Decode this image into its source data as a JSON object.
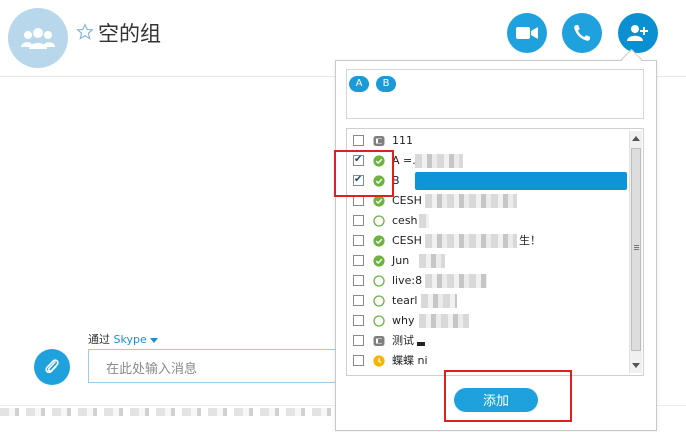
{
  "header": {
    "title": "空的组",
    "buttons": [
      {
        "name": "video-call",
        "icon": "video-camera-icon"
      },
      {
        "name": "audio-call",
        "icon": "phone-icon"
      },
      {
        "name": "add-people",
        "icon": "add-person-icon"
      }
    ]
  },
  "compose": {
    "via_prefix": "通过",
    "via_service": "Skype",
    "input_placeholder": "在此处输入消息"
  },
  "popup": {
    "chips": [
      "A",
      "B"
    ],
    "contacts": [
      {
        "name": "111",
        "status": "group",
        "checked": false
      },
      {
        "name": "A =.",
        "status": "online",
        "checked": true
      },
      {
        "name": "B",
        "status": "online",
        "checked": true,
        "selected": true
      },
      {
        "name": "CESH",
        "status": "online",
        "checked": false
      },
      {
        "name": "cesh",
        "status": "offline",
        "checked": false
      },
      {
        "name": "CESH",
        "suffix": "生！",
        "status": "online",
        "checked": false
      },
      {
        "name": "Jun",
        "status": "online",
        "checked": false
      },
      {
        "name": "live:8",
        "status": "offline",
        "checked": false
      },
      {
        "name": "tearl",
        "status": "offline",
        "checked": false
      },
      {
        "name": "why",
        "status": "offline",
        "checked": false
      },
      {
        "name": "测试",
        "status": "group",
        "checked": false
      },
      {
        "name": "蝶蝶 ni",
        "status": "away",
        "checked": false
      }
    ],
    "add_label": "添加"
  },
  "colors": {
    "accent": "#1ea1dc",
    "selection": "#0e95d8",
    "online": "#6cb33f",
    "away": "#f4b400",
    "highlight": "#e02020"
  }
}
